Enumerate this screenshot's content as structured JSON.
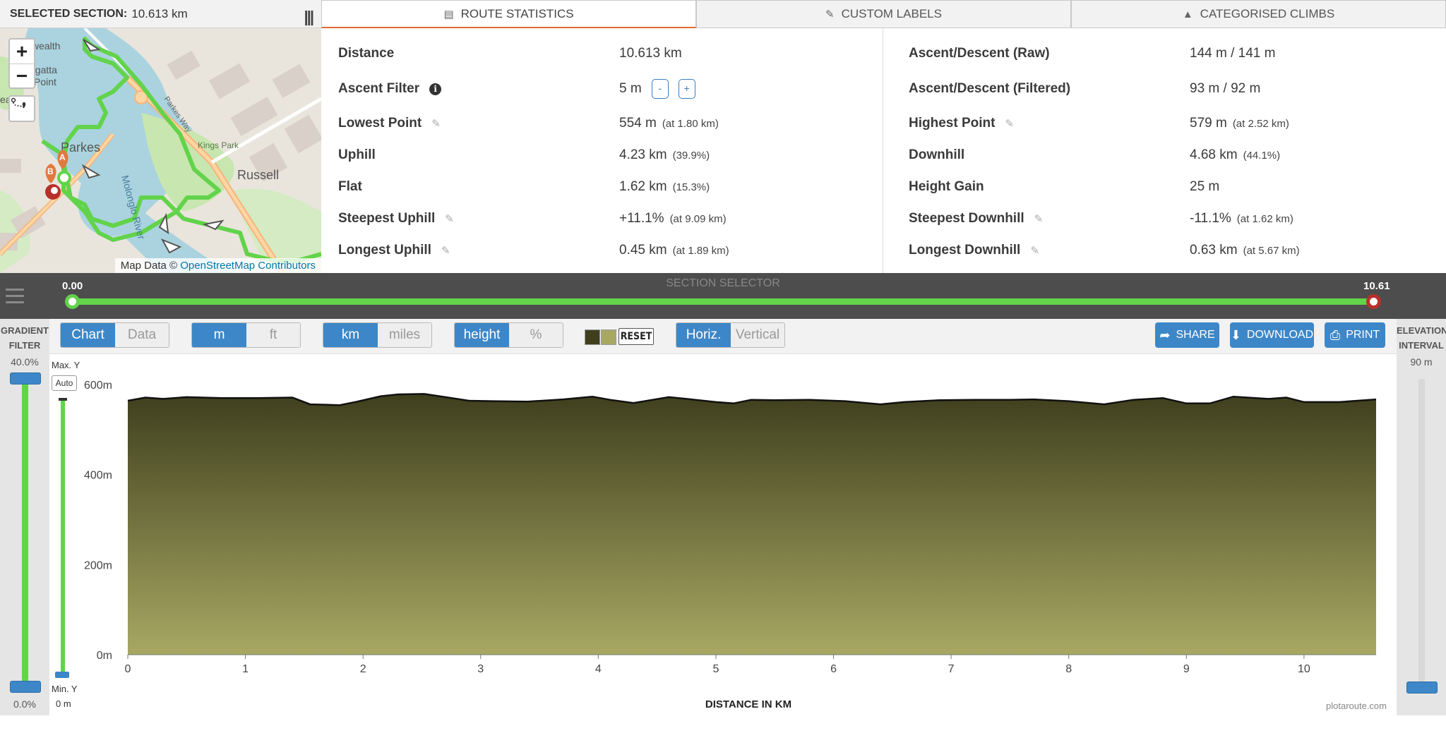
{
  "header": {
    "selected_label": "SELECTED SECTION:",
    "selected_value": "10.613 km",
    "menu_icon": "columns-icon"
  },
  "map": {
    "zoom_in": "+",
    "zoom_out": "−",
    "attribution_prefix": "Map Data ©",
    "attribution_link": "OpenStreetMap Contributors",
    "labels": {
      "regatta": "egatta",
      "point": "Point",
      "parkes": "Parkes",
      "russell": "Russell",
      "kings_park": "Kings Park",
      "parkes_way": "Parkes Way",
      "molonglo": "Molonglo River",
      "wealth": "wealth",
      "ea": "ea"
    },
    "markers": {
      "a": "A",
      "b": "B"
    }
  },
  "tabs": [
    {
      "label": "ROUTE STATISTICS",
      "icon": "list-icon",
      "active": true
    },
    {
      "label": "CUSTOM LABELS",
      "icon": "pencil-icon",
      "active": false
    },
    {
      "label": "CATEGORISED CLIMBS",
      "icon": "mountain-icon",
      "active": false
    }
  ],
  "stats_left": [
    {
      "label": "Distance",
      "value": "10.613 km",
      "extra": ""
    },
    {
      "label": "Ascent Filter",
      "value": "5 m",
      "extra": ""
    },
    {
      "label": "Lowest Point",
      "value": "554 m",
      "extra": "(at 1.80 km)"
    },
    {
      "label": "Uphill",
      "value": "4.23 km",
      "extra": "(39.9%)"
    },
    {
      "label": "Flat",
      "value": "1.62 km",
      "extra": "(15.3%)"
    },
    {
      "label": "Steepest Uphill",
      "value": "+11.1%",
      "extra": "(at 9.09 km)"
    },
    {
      "label": "Longest Uphill",
      "value": "0.45 km",
      "extra": "(at 1.89 km)"
    }
  ],
  "ascent_filter_buttons": {
    "minus": "-",
    "plus": "+"
  },
  "stats_right": [
    {
      "label": "Ascent/Descent (Raw)",
      "value": "144 m / 141 m",
      "extra": ""
    },
    {
      "label": "Ascent/Descent (Filtered)",
      "value": "93 m / 92 m",
      "extra": ""
    },
    {
      "label": "Highest Point",
      "value": "579 m",
      "extra": "(at 2.52 km)"
    },
    {
      "label": "Downhill",
      "value": "4.68 km",
      "extra": "(44.1%)"
    },
    {
      "label": "Height Gain",
      "value": "25 m",
      "extra": ""
    },
    {
      "label": "Steepest Downhill",
      "value": "-11.1%",
      "extra": "(at 1.62 km)"
    },
    {
      "label": "Longest Downhill",
      "value": "0.63 km",
      "extra": "(at 5.67 km)"
    }
  ],
  "section_selector": {
    "title": "SECTION SELECTOR",
    "min_label": "0.00",
    "max_label": "10.61"
  },
  "gradient_filter": {
    "title_line1": "GRADIENT",
    "title_line2": "FILTER",
    "max": "40.0%",
    "min": "0.0%"
  },
  "elevation_interval": {
    "title_line1": "ELEVATION",
    "title_line2": "INTERVAL",
    "value": "90 m"
  },
  "toolbar": {
    "view": [
      "Chart",
      "Data"
    ],
    "units_height": [
      "m",
      "ft"
    ],
    "units_distance": [
      "km",
      "miles"
    ],
    "mode": [
      "height",
      "%"
    ],
    "reset": "RESET",
    "orientation": [
      "Horiz.",
      "Vertical"
    ],
    "share": "SHARE",
    "download": "DOWNLOAD",
    "print": "PRINT",
    "colors": [
      "#3f3f1e",
      "#a8a863"
    ]
  },
  "y_controls": {
    "max_label": "Max. Y",
    "auto": "Auto",
    "min_label": "Min. Y",
    "min_value": "0 m"
  },
  "credit": "plotaroute.com",
  "chart_data": {
    "type": "area",
    "xlabel": "DISTANCE IN KM",
    "ylabel": "",
    "xlim": [
      0,
      10.613
    ],
    "ylim": [
      0,
      600
    ],
    "x_ticks": [
      "0",
      "1",
      "2",
      "3",
      "4",
      "5",
      "6",
      "7",
      "8",
      "9",
      "10"
    ],
    "y_ticks": [
      "600m",
      "400m",
      "200m",
      "0m"
    ],
    "fill_top": "#3f3f1e",
    "fill_bottom": "#a8a863",
    "x": [
      0,
      0.15,
      0.3,
      0.5,
      0.8,
      1.1,
      1.4,
      1.55,
      1.7,
      1.8,
      1.95,
      2.15,
      2.3,
      2.52,
      2.7,
      2.9,
      3.1,
      3.4,
      3.7,
      3.95,
      4.1,
      4.3,
      4.6,
      4.75,
      5.0,
      5.15,
      5.3,
      5.5,
      5.8,
      6.1,
      6.4,
      6.6,
      6.9,
      7.2,
      7.5,
      7.7,
      8.0,
      8.3,
      8.55,
      8.8,
      9.0,
      9.2,
      9.4,
      9.7,
      9.85,
      10.0,
      10.3,
      10.613
    ],
    "y": [
      564,
      571,
      568,
      572,
      570,
      570,
      571,
      556,
      555,
      554,
      562,
      574,
      578,
      579,
      572,
      564,
      563,
      562,
      567,
      573,
      566,
      559,
      572,
      568,
      561,
      558,
      566,
      565,
      566,
      563,
      556,
      561,
      565,
      566,
      566,
      567,
      563,
      556,
      566,
      570,
      558,
      558,
      573,
      568,
      571,
      561,
      561,
      567
    ]
  }
}
